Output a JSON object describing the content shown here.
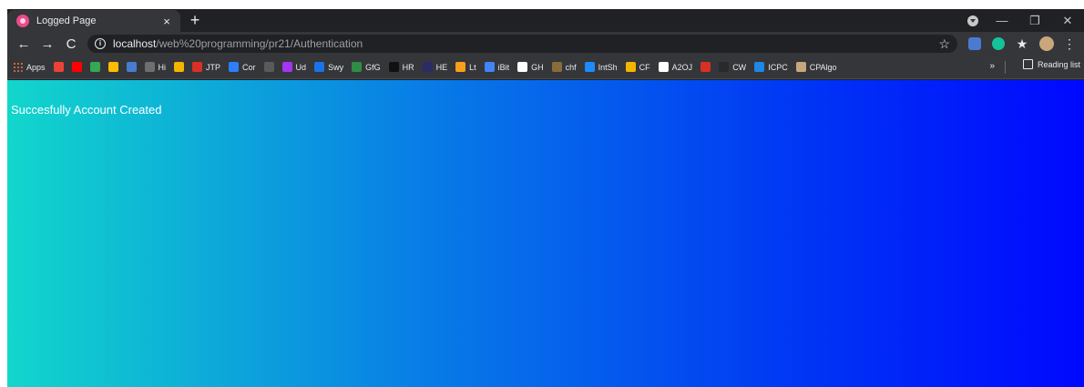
{
  "tab": {
    "title": "Logged Page",
    "close": "×",
    "new_tab": "+"
  },
  "window": {
    "minimize": "—",
    "maximize": "❐",
    "close": "✕"
  },
  "toolbar": {
    "back": "←",
    "forward": "→",
    "reload": "C",
    "url_host": "localhost",
    "url_path": "/web%20programming/pr21/Authentication",
    "star": "☆",
    "puzzle": "★",
    "menu": "⋮"
  },
  "bookmarks": {
    "items": [
      {
        "label": "Apps",
        "color": "#e06c3c"
      },
      {
        "label": "",
        "color": "#ea4335"
      },
      {
        "label": "",
        "color": "#ff0000"
      },
      {
        "label": "",
        "color": "#34a853"
      },
      {
        "label": "",
        "color": "#fbbc05"
      },
      {
        "label": "",
        "color": "#4a7bd0"
      },
      {
        "label": "Hi",
        "color": "#6e6e6e"
      },
      {
        "label": "",
        "color": "#f4b400"
      },
      {
        "label": "JTP",
        "color": "#d93025"
      },
      {
        "label": "Cor",
        "color": "#2d7ff9"
      },
      {
        "label": "",
        "color": "#5a5a5a"
      },
      {
        "label": "Ud",
        "color": "#a435f0"
      },
      {
        "label": "Swy",
        "color": "#1a73e8"
      },
      {
        "label": "GfG",
        "color": "#2f8d46"
      },
      {
        "label": "HR",
        "color": "#111111"
      },
      {
        "label": "HE",
        "color": "#2b2b66"
      },
      {
        "label": "Lt",
        "color": "#f89f1b"
      },
      {
        "label": "iBit",
        "color": "#4285f4"
      },
      {
        "label": "GH",
        "color": "#ffffff"
      },
      {
        "label": "chf",
        "color": "#8b6b3e"
      },
      {
        "label": "IntSh",
        "color": "#1a8cff"
      },
      {
        "label": "CF",
        "color": "#f5b400"
      },
      {
        "label": "A2OJ",
        "color": "#ffffff"
      },
      {
        "label": "",
        "color": "#d93025"
      },
      {
        "label": "CW",
        "color": "#2a2a2a"
      },
      {
        "label": "ICPC",
        "color": "#1e88e5"
      },
      {
        "label": "CPAlgo",
        "color": "#c9a77c"
      }
    ],
    "more": "»",
    "reading_list": "Reading list"
  },
  "page": {
    "message": "Succesfully Account Created"
  },
  "colors": {
    "gradient_start": "#12d6cc",
    "gradient_end": "#0008ff",
    "chrome_dark": "#202124",
    "chrome_toolbar": "#35363a"
  }
}
